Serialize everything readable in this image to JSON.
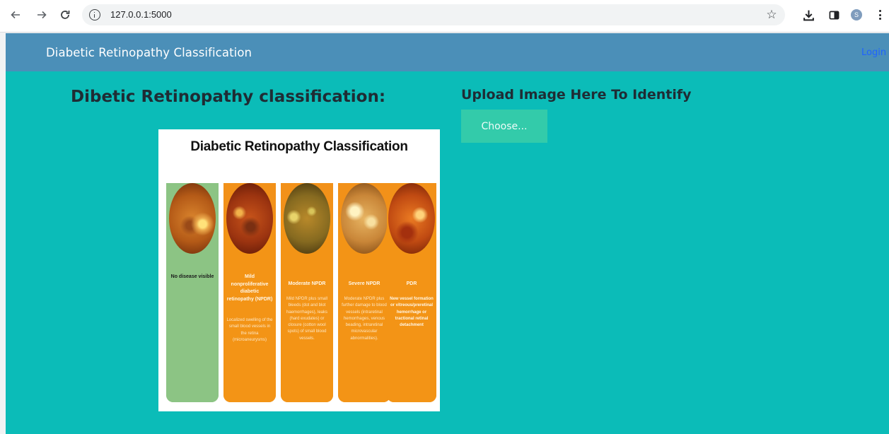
{
  "browser": {
    "url": "127.0.0.1:5000",
    "profile_initial": "S"
  },
  "header": {
    "brand": "Diabetic Retinopathy Classification",
    "login": "Login"
  },
  "main": {
    "left_title": "Dibetic Retinopathy classification:",
    "right_title": "Upload Image Here To Identify",
    "choose_label": "Choose..."
  },
  "figure": {
    "title": "Diabetic Retinopathy Classification",
    "stages": [
      {
        "name": "No disease visible",
        "description": "",
        "color": "#8cc484"
      },
      {
        "name": "Mild nonproliferative diabetic retinopathy (NPDR)",
        "description": "Localized swelling of the small blood vessels in the retina (microaneurysms)",
        "color": "#f39416"
      },
      {
        "name": "Moderate NPDR",
        "description": "Mild NPDR plus small bleeds (dot and blot haemorrhages), leaks (hard exudates) or closure (cotton wool spots) of small blood vessels.",
        "color": "#f39416"
      },
      {
        "name": "Severe NPDR",
        "description": "Moderate NPDR plus further damage to blood vessels (intraretinal hemorrhages, venous beading, intraretinal microvascular abnormalities).",
        "color": "#f39416"
      },
      {
        "name": "PDR",
        "description": "New vessel formation or vitreous/preretinal hemorrhage or tractional retinal detachment",
        "color": "#f39416"
      }
    ]
  },
  "colors": {
    "header_bg": "#4b8fb8",
    "main_bg": "#0bbcb8",
    "button_bg": "#33cbaa",
    "login_link": "#1e63ff"
  }
}
